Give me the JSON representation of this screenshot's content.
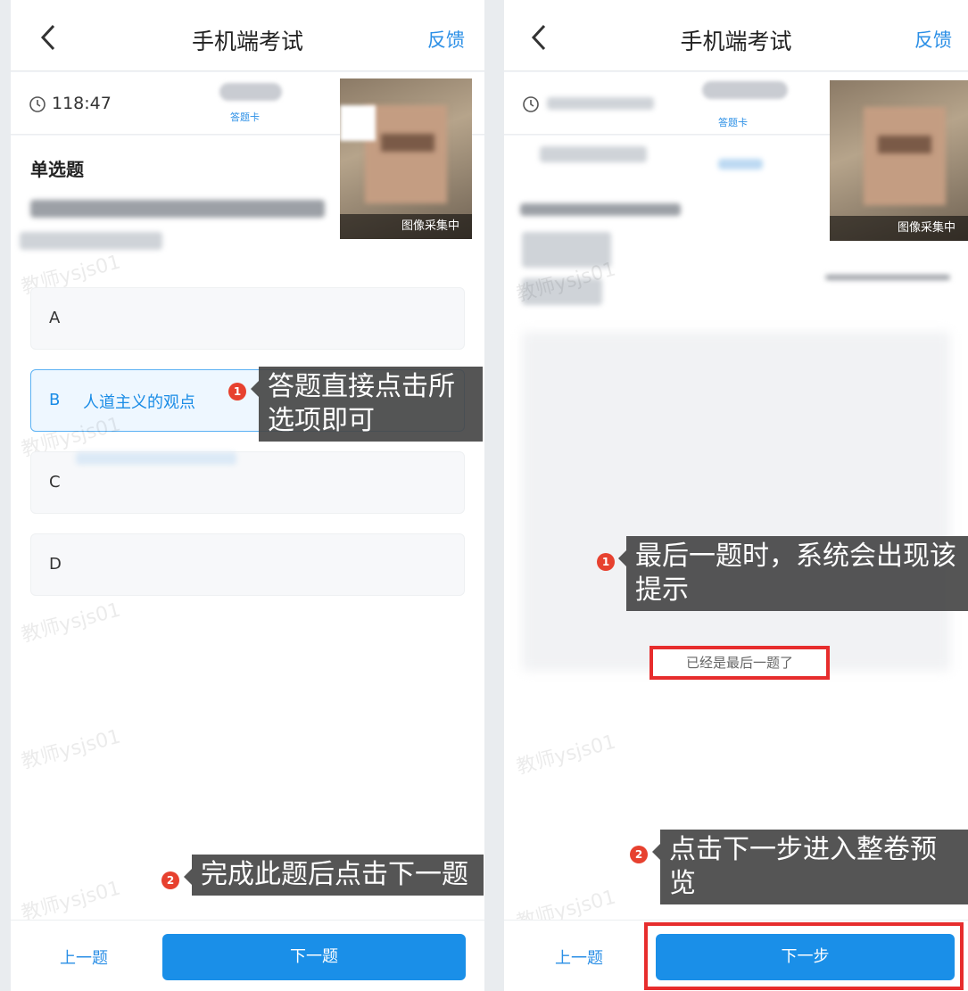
{
  "left": {
    "title": "手机端考试",
    "feedback": "反馈",
    "timer": "118:47",
    "card_label": "答题卡",
    "camera_label": "图像采集中",
    "question_type": "单选题",
    "options": [
      {
        "letter": "A",
        "text": ""
      },
      {
        "letter": "B",
        "text": "人道主义的观点"
      },
      {
        "letter": "C",
        "text": ""
      },
      {
        "letter": "D",
        "text": ""
      }
    ],
    "watermark": "教师ysjs01",
    "prev_label": "上一题",
    "next_label": "下一题",
    "callout_1": "答题直接点击所选项即可",
    "callout_2": "完成此题后点击下一题",
    "badge_1": "1",
    "badge_2": "2"
  },
  "right": {
    "title": "手机端考试",
    "feedback": "反馈",
    "card_label": "答题卡",
    "camera_label": "图像采集中",
    "toast": "已经是最后一题了",
    "watermark": "教师ysjs01",
    "prev_label": "上一题",
    "next_label": "下一步",
    "callout_1": "最后一题时，系统会出现该提示",
    "callout_2": "点击下一步进入整卷预览",
    "badge_1": "1",
    "badge_2": "2"
  },
  "colors": {
    "accent": "#1a8fe8",
    "highlight": "#e72d2d",
    "badge": "#e7412f"
  }
}
